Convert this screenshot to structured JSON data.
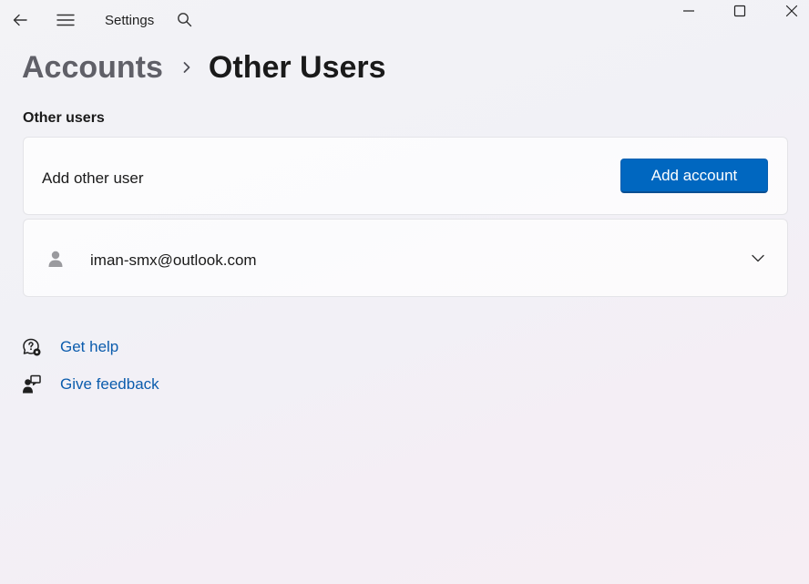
{
  "titlebar": {
    "app_title": "Settings",
    "icons": {
      "back": "back-arrow-icon",
      "menu": "hamburger-menu-icon",
      "search": "search-icon",
      "minimize": "minimize-icon",
      "maximize": "maximize-icon",
      "close": "close-icon"
    }
  },
  "breadcrumb": {
    "parent": "Accounts",
    "current": "Other Users"
  },
  "section": {
    "title": "Other users"
  },
  "add_user_card": {
    "label": "Add other user",
    "button_label": "Add account"
  },
  "user_card": {
    "email": "iman-smx@outlook.com"
  },
  "links": {
    "get_help": "Get help",
    "give_feedback": "Give feedback"
  },
  "colors": {
    "accent": "#0067c0",
    "link": "#0b5cad"
  }
}
